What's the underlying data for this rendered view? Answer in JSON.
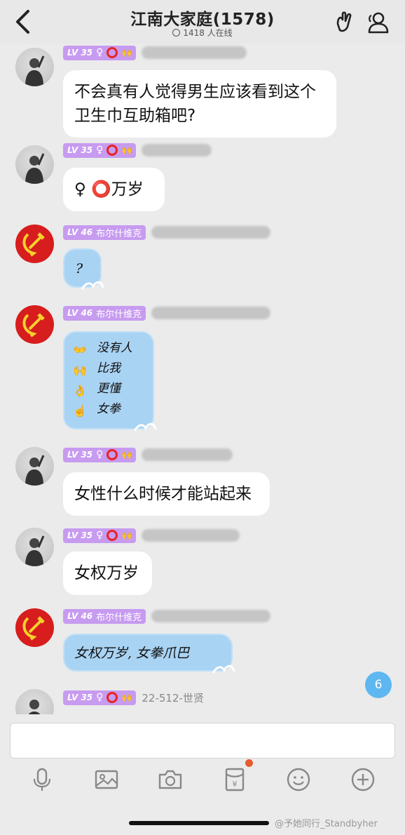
{
  "header": {
    "title": "江南大家庭(1578)",
    "online": "1418 人在线"
  },
  "messages": [
    {
      "level": "LV 35",
      "name": "",
      "text": "不会真有人觉得男生应该看到这个\n卫生巾互助箱吧?",
      "type": "user"
    },
    {
      "level": "LV 35",
      "name": "",
      "text": "♀ ⭕万岁",
      "type": "user"
    },
    {
      "level": "LV 46",
      "title": "布尔什维克",
      "text": "?",
      "type": "party"
    },
    {
      "level": "LV 46",
      "title": "布尔什维克",
      "text": "没有人\n比我\n更懂\n女拳",
      "type": "party"
    },
    {
      "level": "LV 35",
      "name": "",
      "text": "女性什么时候才能站起来",
      "type": "user"
    },
    {
      "level": "LV 35",
      "name": "",
      "text": "女权万岁",
      "type": "user"
    },
    {
      "level": "LV 46",
      "title": "布尔什维克",
      "text": "女权万岁, 女拳爪巴",
      "type": "party"
    },
    {
      "level": "LV 35",
      "name": "22-512-世贤",
      "text": "",
      "type": "user"
    }
  ],
  "unread_count": "6",
  "watermark": "@予她同行_Standbyher",
  "colors": {
    "badge_purple": "#c79bf0",
    "bubble_blue": "#a9d3f3",
    "unread_blue": "#5eb7f0",
    "party_red": "#d71d1d"
  },
  "icons": [
    "back-icon",
    "sign-icon",
    "members-icon",
    "mic-icon",
    "image-icon",
    "camera-icon",
    "red-packet-icon",
    "emoji-icon",
    "plus-icon"
  ]
}
